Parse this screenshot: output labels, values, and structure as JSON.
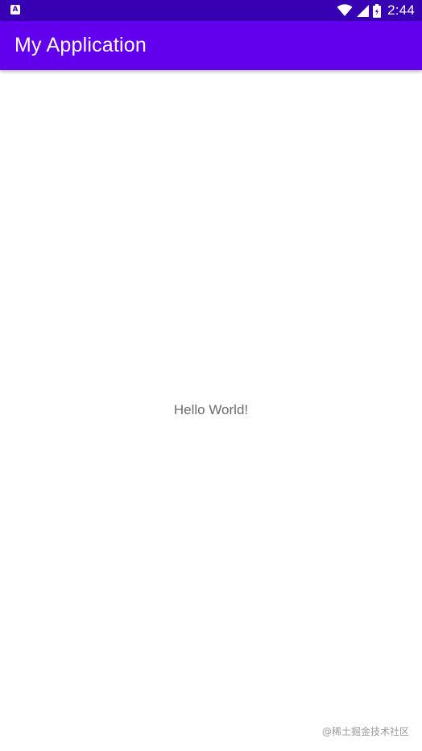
{
  "status_bar": {
    "app_icon_letter": "A",
    "time": "2:44",
    "icons": [
      "wifi-icon",
      "cell-signal-icon",
      "battery-icon"
    ],
    "background": "#3700b3"
  },
  "app_bar": {
    "title": "My Application",
    "background": "#6200ee"
  },
  "main": {
    "message": "Hello World!"
  },
  "watermark": {
    "text": "@稀土掘金技术社区"
  }
}
